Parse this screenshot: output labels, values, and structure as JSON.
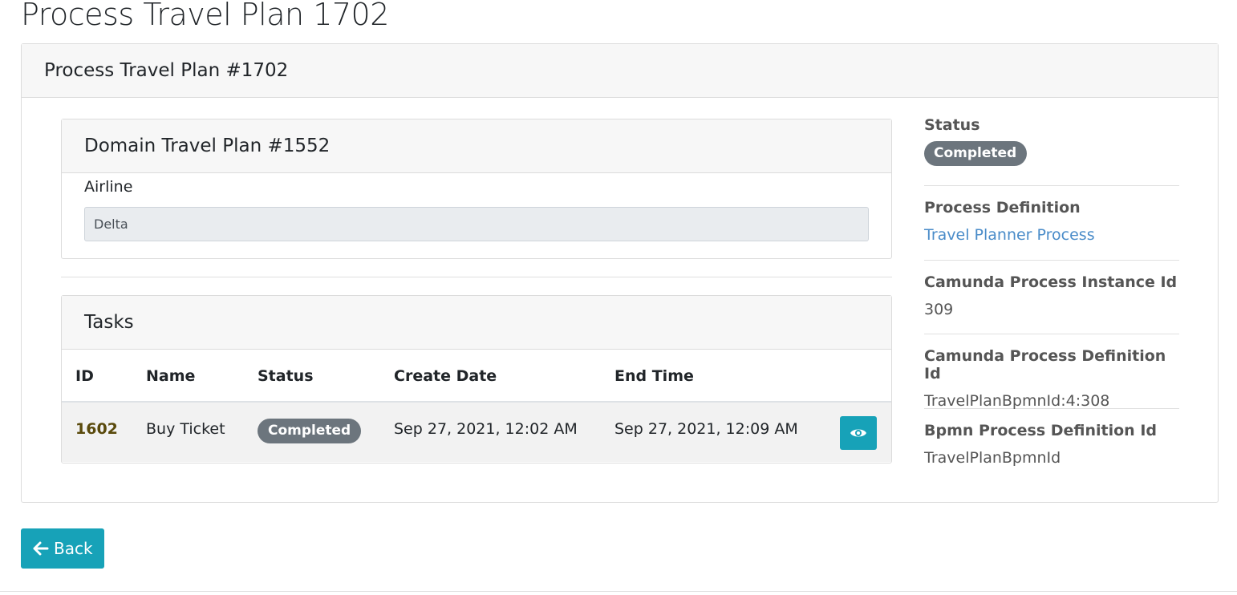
{
  "page": {
    "title": "Process Travel Plan 1702"
  },
  "process_card": {
    "header": "Process Travel Plan #1702"
  },
  "domain_card": {
    "header": "Domain Travel Plan #1552",
    "fields": [
      {
        "label": "Airline",
        "value": "Delta"
      }
    ]
  },
  "tasks": {
    "header": "Tasks",
    "columns": [
      "ID",
      "Name",
      "Status",
      "Create Date",
      "End Time"
    ],
    "rows": [
      {
        "id": "1602",
        "name": "Buy Ticket",
        "status": "Completed",
        "create_date": "Sep 27, 2021, 12:02 AM",
        "end_time": "Sep 27, 2021, 12:09 AM",
        "action_icon": "eye-icon"
      }
    ]
  },
  "sidebar": {
    "status_label": "Status",
    "status_value": "Completed",
    "process_definition_label": "Process Definition",
    "process_definition_value": "Travel Planner Process",
    "instance_id_label": "Camunda Process Instance Id",
    "instance_id_value": "309",
    "definition_id_label": "Camunda Process Definition Id",
    "definition_id_value": "TravelPlanBpmnId:4:308",
    "bpmn_id_label": "Bpmn Process Definition Id",
    "bpmn_id_value": "TravelPlanBpmnId"
  },
  "actions": {
    "back_label": "Back",
    "back_icon": "arrow-left-icon"
  },
  "colors": {
    "accent": "#17a2b8",
    "badge": "#6c757d",
    "link": "#4a8cc9"
  }
}
